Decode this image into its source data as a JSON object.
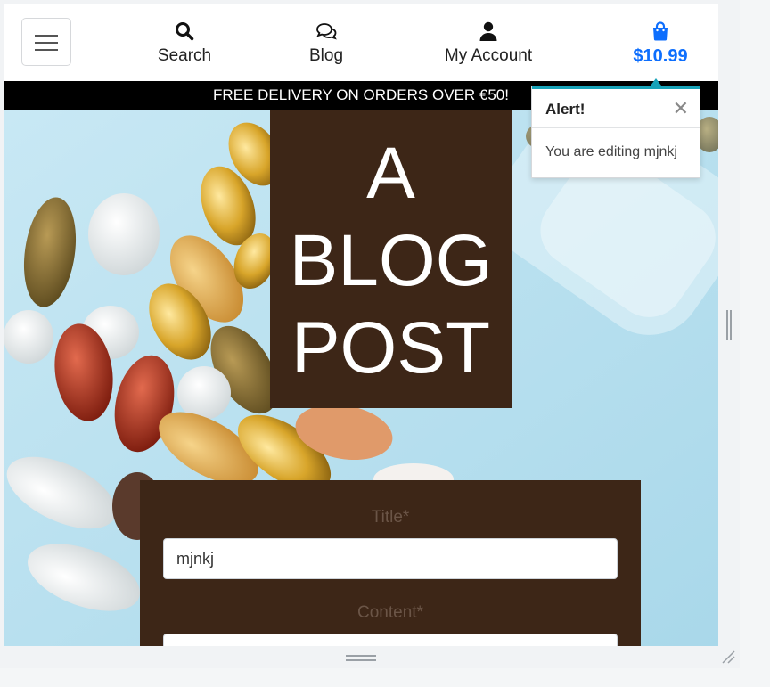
{
  "nav": {
    "menu_icon": "hamburger-menu-icon",
    "items": [
      {
        "label": "Search",
        "icon": "search-icon"
      },
      {
        "label": "Blog",
        "icon": "chat-bubbles-icon"
      },
      {
        "label": "My Account",
        "icon": "user-icon"
      }
    ],
    "cart": {
      "label": "$10.99",
      "icon": "shopping-bag-icon"
    }
  },
  "banner": {
    "text": "FREE DELIVERY ON ORDERS OVER €50!"
  },
  "hero": {
    "title_lines": [
      "A",
      "BLOG",
      "POST"
    ]
  },
  "form": {
    "title_label": "Title*",
    "title_value": "mjnkj",
    "content_label": "Content*",
    "content_value": ""
  },
  "toast": {
    "title": "Alert!",
    "close": "✕",
    "message": "You are editing mjnkj"
  },
  "colors": {
    "accent": "#0d6efd",
    "hero_box": "#3d2617",
    "toast_bar": "#17a2b8",
    "banner": "#000000"
  }
}
